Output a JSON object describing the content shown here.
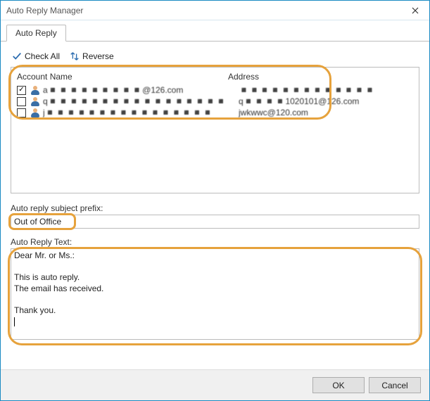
{
  "window": {
    "title": "Auto Reply Manager"
  },
  "tabs": [
    {
      "label": "Auto Reply"
    }
  ],
  "toolbar": {
    "check_all_label": "Check All",
    "reverse_label": "Reverse"
  },
  "columns": {
    "account": "Account Name",
    "address": "Address"
  },
  "accounts": [
    {
      "checked": true,
      "name": "a◾◾◾◾◾◾◾◾◾@126.com",
      "address": "◾◾◾◾◾◾◾◾◾◾◾◾◾"
    },
    {
      "checked": false,
      "name": "q◾◾◾◾◾◾◾◾◾◾◾◾◾◾◾◾◾",
      "address": "q◾◾◾◾1020101@126.com"
    },
    {
      "checked": false,
      "name": "j◾◾◾◾◾◾◾◾◾◾◾◾◾◾◾◾",
      "address": "jwkwwc@120.com"
    }
  ],
  "subject_prefix": {
    "label": "Auto reply subject prefix:",
    "value": "Out of Office"
  },
  "reply_text": {
    "label": "Auto Reply Text:",
    "value": "Dear Mr. or Ms.:\n\nThis is auto reply.\nThe email has received.\n\nThank you.\n"
  },
  "buttons": {
    "ok": "OK",
    "cancel": "Cancel"
  },
  "colors": {
    "window_border": "#1a8ac2",
    "highlight": "#e6a23c",
    "control_border": "#bcbcbc"
  }
}
